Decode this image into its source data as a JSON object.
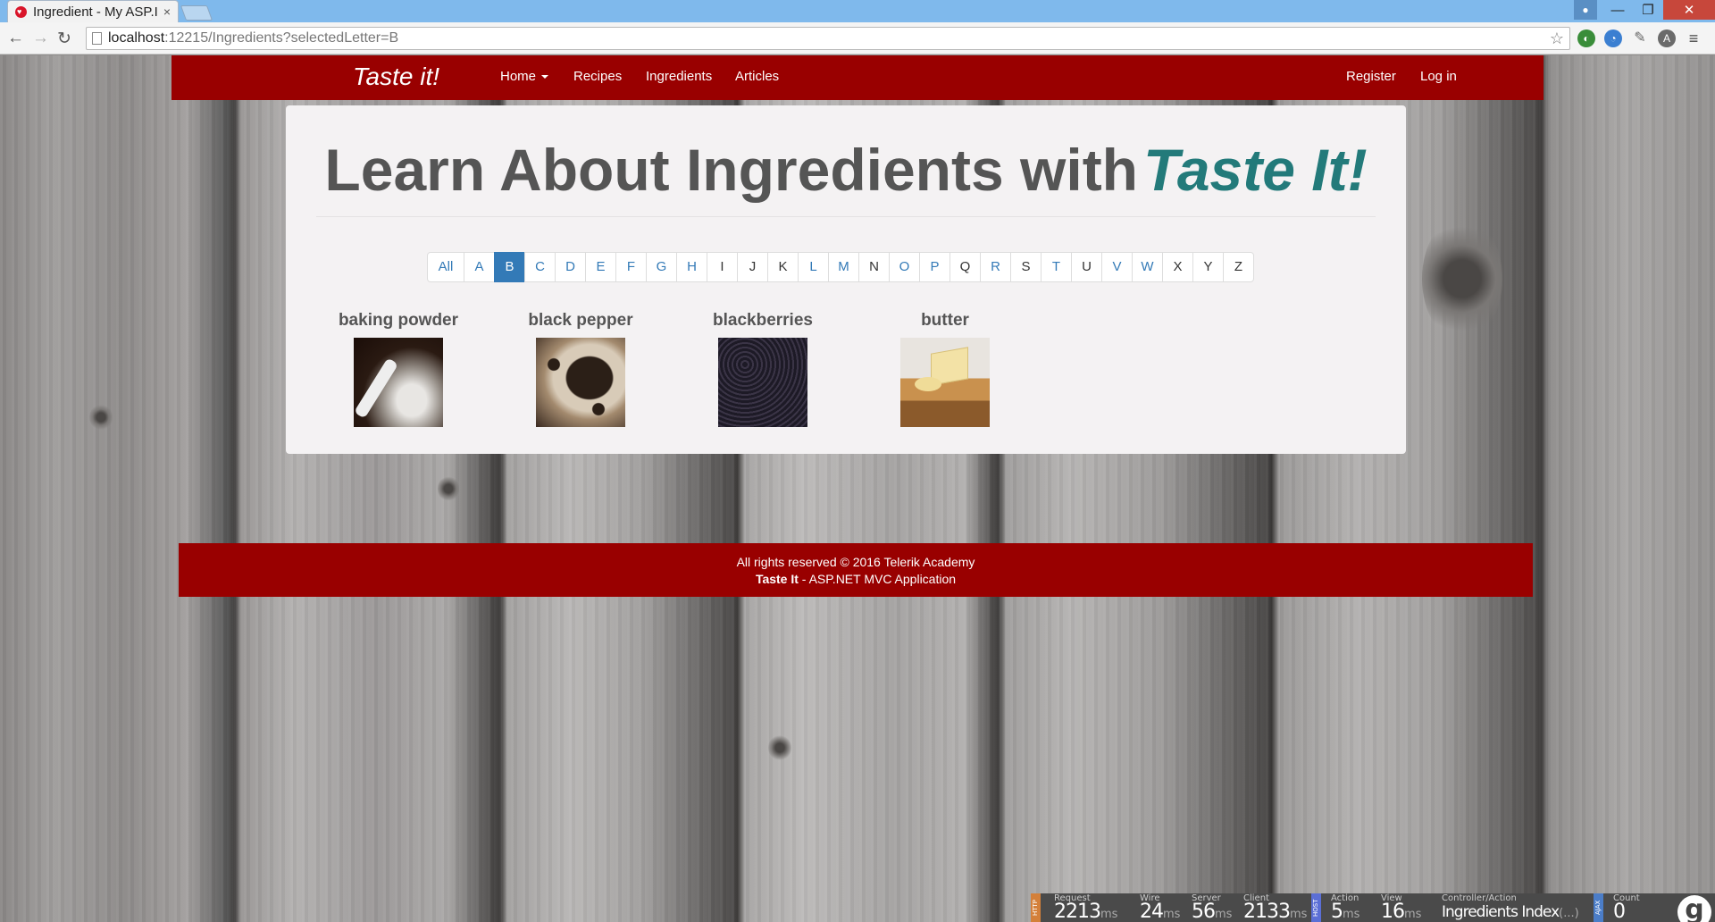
{
  "browser": {
    "tab_title": "Ingredient - My ASP.I",
    "tab_close": "×",
    "url_host": "localhost",
    "url_rest": ":12215/Ingredients?selectedLetter=B"
  },
  "nav": {
    "brand": "Taste it!",
    "links": [
      "Home",
      "Recipes",
      "Ingredients",
      "Articles"
    ],
    "register": "Register",
    "login": "Log in"
  },
  "hero": {
    "text": "Learn About Ingredients with",
    "accent": "Taste It!"
  },
  "letters": [
    "All",
    "A",
    "B",
    "C",
    "D",
    "E",
    "F",
    "G",
    "H",
    "I",
    "J",
    "K",
    "L",
    "M",
    "N",
    "O",
    "P",
    "Q",
    "R",
    "S",
    "T",
    "U",
    "V",
    "W",
    "X",
    "Y",
    "Z"
  ],
  "selected_letter": "B",
  "ingredients": [
    {
      "name": "baking powder"
    },
    {
      "name": "black pepper"
    },
    {
      "name": "blackberries"
    },
    {
      "name": "butter"
    }
  ],
  "footer": {
    "line1": "All rights reserved © 2016 Telerik Academy",
    "line2_brand": "Taste It",
    "line2_rest": " - ASP.NET MVC Application"
  },
  "glimpse": {
    "http_tag": "HTTP",
    "host_tag": "HOST",
    "ajax_tag": "AJAX",
    "request": {
      "label": "Request",
      "value": "2213",
      "unit": "ms"
    },
    "wire": {
      "label": "Wire",
      "value": "24",
      "unit": "ms"
    },
    "server": {
      "label": "Server",
      "value": "56",
      "unit": "ms"
    },
    "client": {
      "label": "Client",
      "value": "2133",
      "unit": "ms"
    },
    "action": {
      "label": "Action",
      "value": "5",
      "unit": "ms"
    },
    "view": {
      "label": "View",
      "value": "16",
      "unit": "ms"
    },
    "controller": {
      "label": "Controller/Action",
      "value": "Ingredients Index",
      "unit": "(...)"
    },
    "count": {
      "label": "Count",
      "value": "0"
    },
    "logo": "g"
  },
  "colors": {
    "brand_red": "#990000",
    "accent_teal": "#237a7a",
    "pager_blue": "#337ab7"
  }
}
